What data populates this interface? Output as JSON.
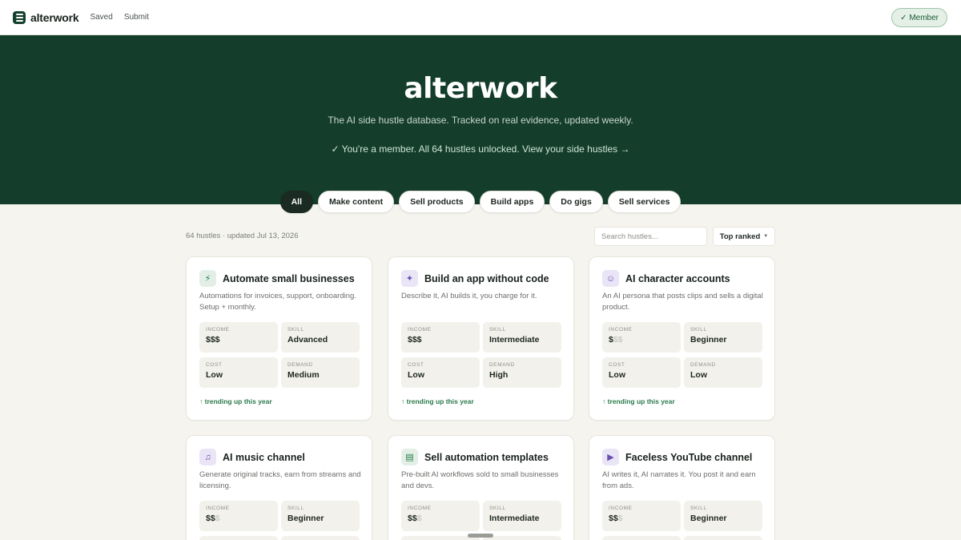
{
  "nav": {
    "logo": "alterwork",
    "links": [
      "Saved",
      "Submit"
    ],
    "member_button": "✓ Member"
  },
  "hero": {
    "title": "alterwork",
    "subtitle": "The AI side hustle database. Tracked on real evidence, updated weekly.",
    "member_note": "✓ You're a member. All 64 hustles unlocked. View your side hustles →"
  },
  "categories": [
    "All",
    "Make content",
    "Sell products",
    "Build apps",
    "Do gigs",
    "Sell services"
  ],
  "toolbar": {
    "meta": "64 hustles · updated Jul 13, 2026",
    "search_placeholder": "Search hustles...",
    "sort_label": "Top ranked",
    "sort_caret": "▼"
  },
  "stat_labels": {
    "income": "INCOME",
    "skill": "SKILL",
    "cost": "COST",
    "demand": "DEMAND"
  },
  "cards": [
    {
      "icon": "bolt-icon",
      "glyph": "⚡",
      "icon_tint": "green",
      "title": "Automate small businesses",
      "desc": "Automations for invoices, support, onboarding. Setup + monthly.",
      "income_on": "$$$",
      "income_off": "",
      "skill": "Advanced",
      "cost": "Low",
      "demand": "Medium",
      "trend": "↑ trending up this year"
    },
    {
      "icon": "magic-wand-icon",
      "glyph": "✦",
      "icon_tint": "purple",
      "title": "Build an app without code",
      "desc": "Describe it, AI builds it, you charge for it.",
      "income_on": "$$$",
      "income_off": "",
      "skill": "Intermediate",
      "cost": "Low",
      "demand": "High",
      "trend": "↑ trending up this year"
    },
    {
      "icon": "mask-icon",
      "glyph": "☺",
      "icon_tint": "purple",
      "title": "AI character accounts",
      "desc": "An AI persona that posts clips and sells a digital product.",
      "income_on": "$",
      "income_off": "$$",
      "skill": "Beginner",
      "cost": "Low",
      "demand": "Low",
      "trend": "↑ trending up this year"
    },
    {
      "icon": "music-note-icon",
      "glyph": "♫",
      "icon_tint": "purple",
      "title": "AI music channel",
      "desc": "Generate original tracks, earn from streams and licensing.",
      "income_on": "$$",
      "income_off": "$",
      "skill": "Beginner"
    },
    {
      "icon": "briefcase-icon",
      "glyph": "▤",
      "icon_tint": "green",
      "title": "Sell automation templates",
      "desc": "Pre-built AI workflows sold to small businesses and devs.",
      "income_on": "$$",
      "income_off": "$",
      "skill": "Intermediate"
    },
    {
      "icon": "video-icon",
      "glyph": "▶",
      "icon_tint": "purple",
      "title": "Faceless YouTube channel",
      "desc": "AI writes it, AI narrates it. You post it and earn from ads.",
      "income_on": "$$",
      "income_off": "$",
      "skill": "Beginner"
    }
  ]
}
